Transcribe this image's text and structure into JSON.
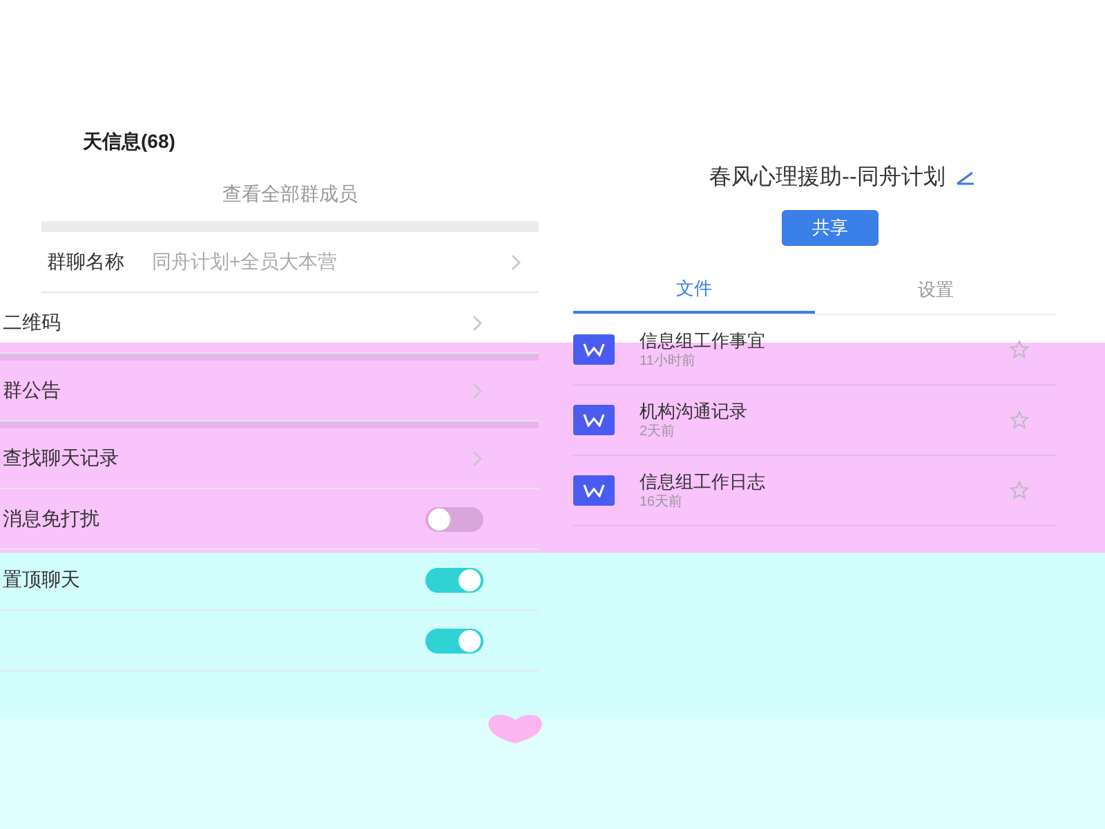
{
  "left": {
    "title": "天信息(68)",
    "members_link": "查看全部群成员",
    "rows": [
      {
        "kind": "value",
        "label": "群聊名称",
        "value": "同舟计划+全员大本营"
      },
      {
        "kind": "link",
        "label": "二维码"
      },
      {
        "kind": "link",
        "label": "群公告"
      },
      {
        "kind": "link",
        "label": "查找聊天记录"
      },
      {
        "kind": "toggle",
        "label": "消息免打扰",
        "on": false
      },
      {
        "kind": "toggle",
        "label": "置顶聊天",
        "on": true
      },
      {
        "kind": "toggle",
        "on": true
      }
    ]
  },
  "right": {
    "title": "春风心理援助--同舟计划",
    "share_button": "共享",
    "tabs": [
      {
        "label": "文件",
        "selected": true
      },
      {
        "label": "设置",
        "selected": false
      }
    ],
    "files": [
      {
        "name": "信息组工作事宜",
        "time": "11小时前",
        "starred": false
      },
      {
        "name": "机构沟通记录",
        "time": "2天前",
        "starred": false
      },
      {
        "name": "信息组工作日志",
        "time": "16天前",
        "starred": false
      }
    ]
  }
}
